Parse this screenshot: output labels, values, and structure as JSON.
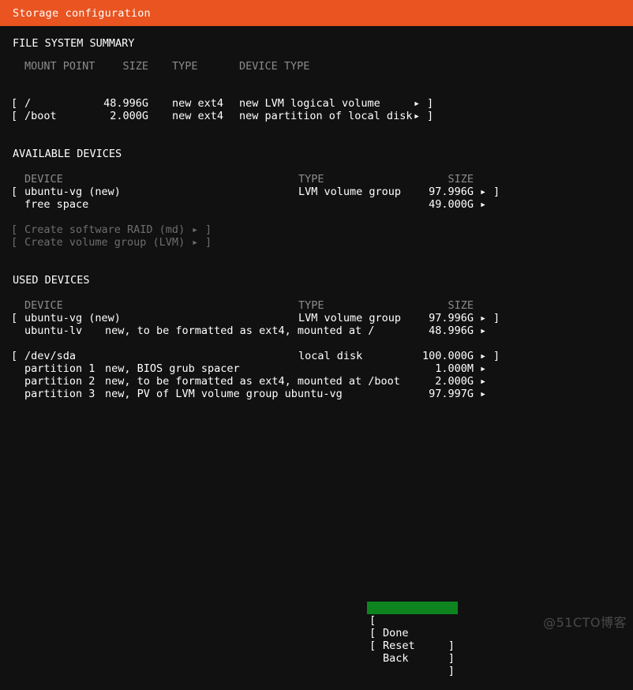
{
  "header": {
    "title": "Storage configuration"
  },
  "colors": {
    "header_bg": "#e95420",
    "background": "#111111",
    "text": "#ffffff",
    "muted": "#8b8b8b",
    "disabled": "#6d6d6d",
    "selected_bg": "#0e8420"
  },
  "glyphs": {
    "arrow": "▸",
    "bracket_open": "[",
    "bracket_close": "]"
  },
  "file_system_summary": {
    "heading": "FILE SYSTEM SUMMARY",
    "columns": {
      "mount_point": "MOUNT POINT",
      "size": "SIZE",
      "type": "TYPE",
      "device_type": "DEVICE TYPE"
    },
    "rows": [
      {
        "mount_point": "/",
        "size": "48.996G",
        "type": "new ext4",
        "device_type": "new LVM logical volume"
      },
      {
        "mount_point": "/boot",
        "size": "2.000G",
        "type": "new ext4",
        "device_type": "new partition of local disk"
      }
    ]
  },
  "available_devices": {
    "heading": "AVAILABLE DEVICES",
    "columns": {
      "device": "DEVICE",
      "type": "TYPE",
      "size": "SIZE"
    },
    "rows": [
      {
        "device": "ubuntu-vg (new)",
        "type": "LVM volume group",
        "size": "97.996G",
        "bracketed": true
      },
      {
        "device": "free space",
        "type": "",
        "size": "49.000G",
        "bracketed": false
      }
    ],
    "actions": [
      {
        "label": "Create software RAID (md)",
        "enabled": false
      },
      {
        "label": "Create volume group (LVM)",
        "enabled": false
      }
    ]
  },
  "used_devices": {
    "heading": "USED DEVICES",
    "columns": {
      "device": "DEVICE",
      "type": "TYPE",
      "size": "SIZE"
    },
    "groups": [
      {
        "device": "ubuntu-vg (new)",
        "type": "LVM volume group",
        "size": "97.996G",
        "children": [
          {
            "name": "ubuntu-lv",
            "detail": "new, to be formatted as ext4, mounted at /",
            "size": "48.996G"
          }
        ]
      },
      {
        "device": "/dev/sda",
        "type": "local disk",
        "size": "100.000G",
        "children": [
          {
            "name": "partition 1",
            "detail": "new, BIOS grub spacer",
            "size": "1.000M"
          },
          {
            "name": "partition 2",
            "detail": "new, to be formatted as ext4, mounted at /boot",
            "size": "2.000G"
          },
          {
            "name": "partition 3",
            "detail": "new, PV of LVM volume group ubuntu-vg",
            "size": "97.997G"
          }
        ]
      }
    ]
  },
  "buttons": [
    {
      "label": "Done",
      "selected": true
    },
    {
      "label": "Reset",
      "selected": false
    },
    {
      "label": "Back",
      "selected": false
    }
  ],
  "watermark": {
    "text": "@51CTO博客"
  }
}
